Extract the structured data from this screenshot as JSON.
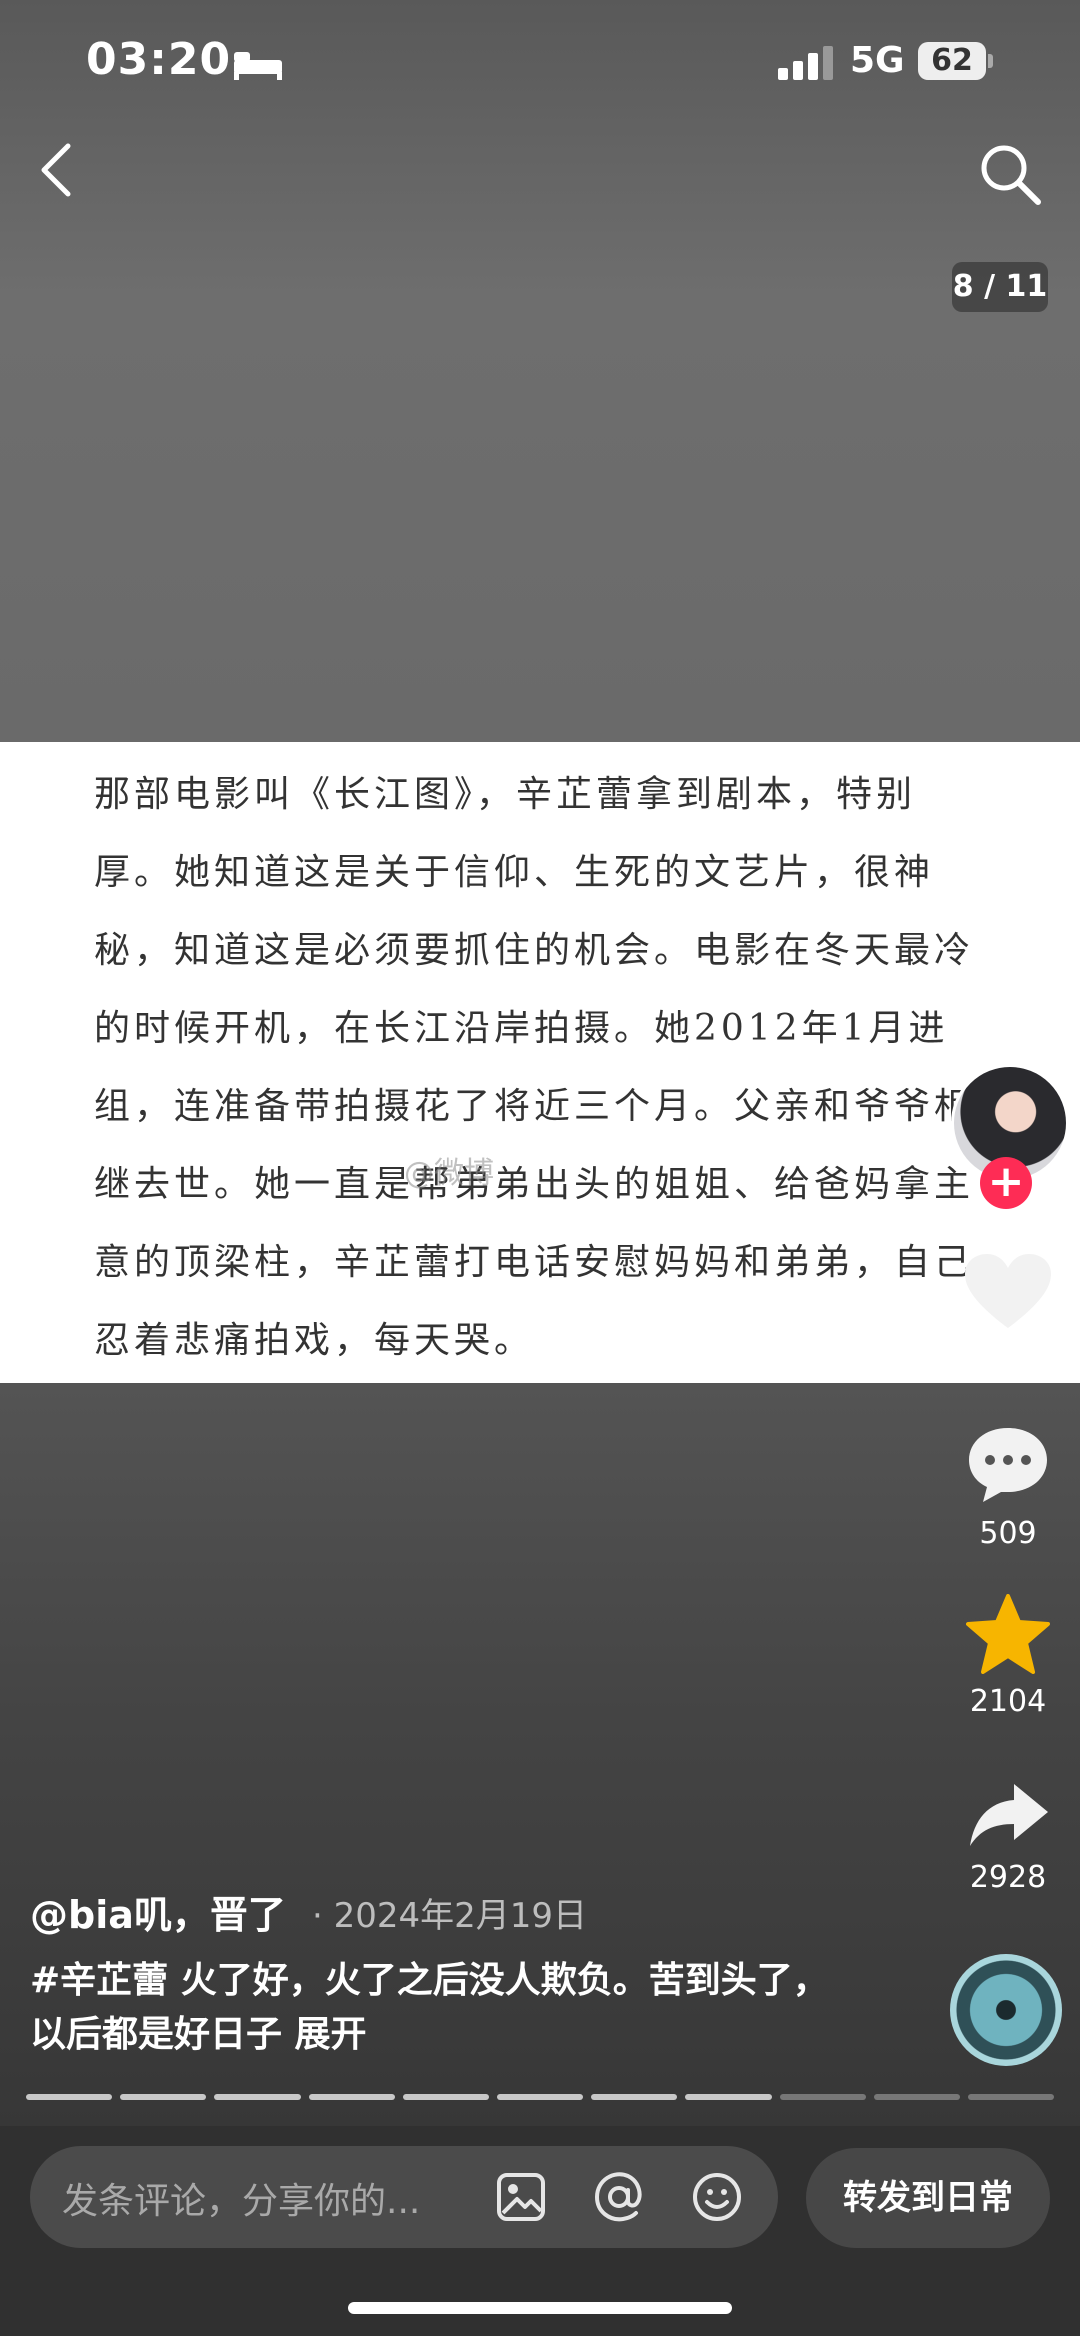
{
  "status_bar": {
    "time": "03:20",
    "network": "5G",
    "battery": "62"
  },
  "viewer": {
    "page_counter": "8 / 11"
  },
  "article": {
    "text": "那部电影叫《长江图》，辛芷蕾拿到剧本，特别厚。她知道这是关于信仰、生死的文艺片，很神秘，知道这是必须要抓住的机会。电影在冬天最冷的时候开机，在长江沿岸拍摄。她2012年1月进组，连准备带拍摄花了将近三个月。父亲和爷爷相继去世。她一直是帮弟弟出头的姐姐、给爸妈拿主意的顶梁柱，辛芷蕾打电话安慰妈妈和弟弟，自己忍着悲痛拍戏，每天哭。",
    "watermark": "@微博"
  },
  "rail": {
    "follow_plus": "+",
    "comments_count": "509",
    "favorites_count": "2104",
    "shares_count": "2928"
  },
  "post": {
    "author": "@bia叽，晋了",
    "date": "· 2024年2月19日",
    "caption": "#辛芷蕾 火了好，火了之后没人欺负。苦到头了，以后都是好日子 展开"
  },
  "progress": {
    "total": 11,
    "current": 8
  },
  "bottom_bar": {
    "comment_placeholder": "发条评论，分享你的...",
    "share_label": "转发到日常"
  },
  "icons": [
    "back-icon",
    "search-icon",
    "heart-icon",
    "comment-icon",
    "star-icon",
    "share-icon",
    "image-icon",
    "mention-icon",
    "emoji-icon"
  ],
  "colors": {
    "accent": "#fe2c55",
    "star": "#f7b500"
  }
}
